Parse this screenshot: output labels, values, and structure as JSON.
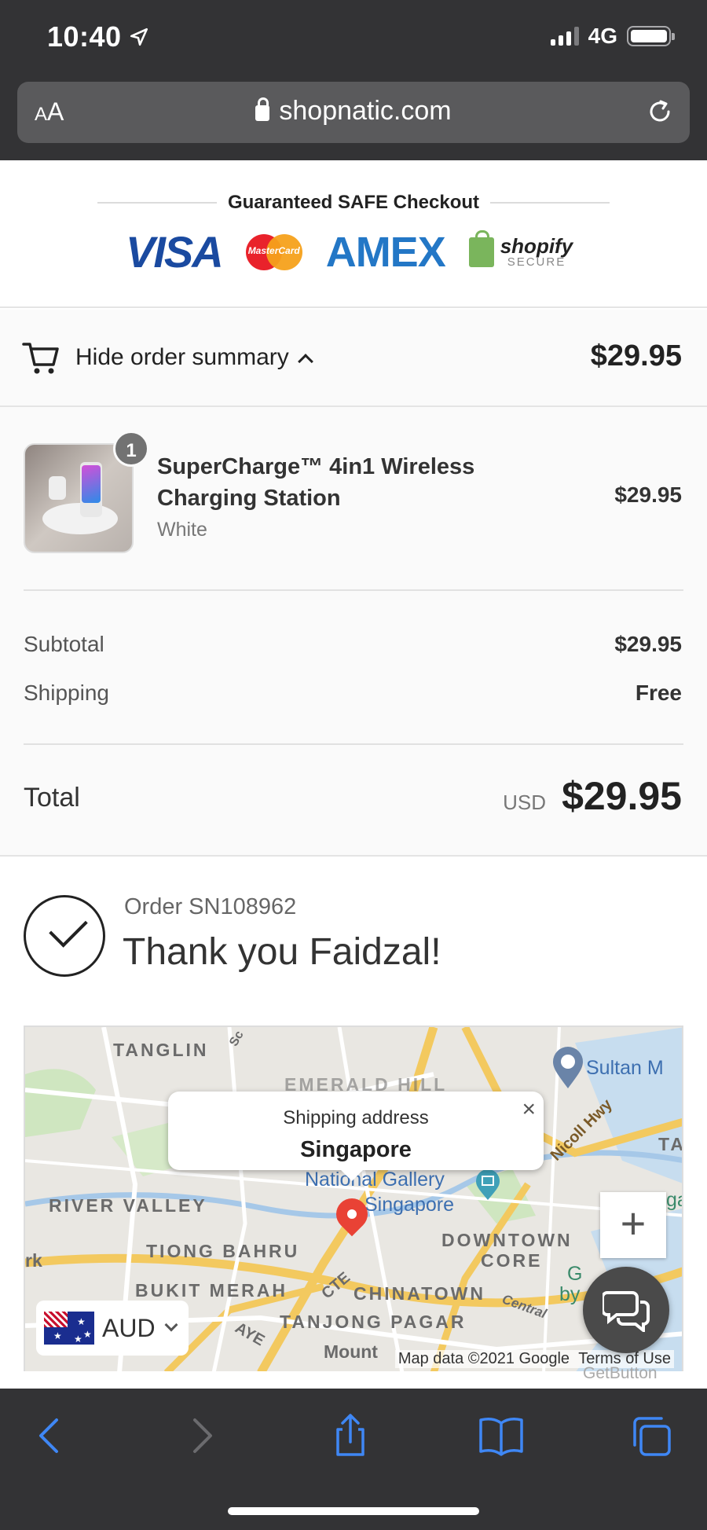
{
  "status_bar": {
    "time": "10:40",
    "network": "4G"
  },
  "browser": {
    "text_size_label": "AA",
    "url": "shopnatic.com"
  },
  "checkout_badge": {
    "title": "Guaranteed SAFE Checkout",
    "logos": [
      "VISA",
      "MasterCard",
      "AMEX",
      "shopify"
    ],
    "shopify_sub": "SECURE"
  },
  "order_summary": {
    "toggle_label": "Hide order summary",
    "toggle_price": "$29.95",
    "item": {
      "quantity": "1",
      "name": "SuperCharge™ 4in1 Wireless Charging Station",
      "variant": "White",
      "price": "$29.95"
    },
    "subtotal_label": "Subtotal",
    "subtotal_value": "$29.95",
    "shipping_label": "Shipping",
    "shipping_value": "Free",
    "total_label": "Total",
    "total_currency": "USD",
    "total_value": "$29.95"
  },
  "confirmation": {
    "order_number": "Order SN108962",
    "thank_you": "Thank you Faidzal!"
  },
  "map": {
    "popup_title": "Shipping address",
    "popup_location": "Singapore",
    "labels": {
      "tanglin": "TANGLIN",
      "emerald_hill": "EMERALD HILL",
      "river_valley": "RIVER VALLEY",
      "tiong_bahru": "TIONG BAHRU",
      "downtown": "DOWNTOWN",
      "core": "CORE",
      "bukit_merah": "BUKIT MERAH",
      "chinatown": "CHINATOWN",
      "tanjong_pagar": "TANJONG PAGAR",
      "national_gallery": "National Gallery",
      "singapore_poi": "Singapore",
      "sultan": "Sultan M",
      "nicoll_hwy": "Nicoll Hwy",
      "cte": "CTE",
      "aye": "AYE",
      "central": "Central",
      "mount": "Mount",
      "rk": "rk",
      "scotts": "Sc",
      "ta": "TA",
      "ga": "ga",
      "g_by": "G",
      "by": "by"
    },
    "credit": "Map data ©2021 Google",
    "terms": "Terms of Use",
    "zoom_in": "+"
  },
  "currency_selector": {
    "value": "AUD"
  },
  "chat_widget": {
    "credit": "GetButton"
  },
  "colors": {
    "chrome": "#333335",
    "toolbar_icon": "#3f87f5",
    "visa": "#1a4aa0",
    "amex": "#2377c6",
    "shopify_green": "#7ab55c"
  }
}
